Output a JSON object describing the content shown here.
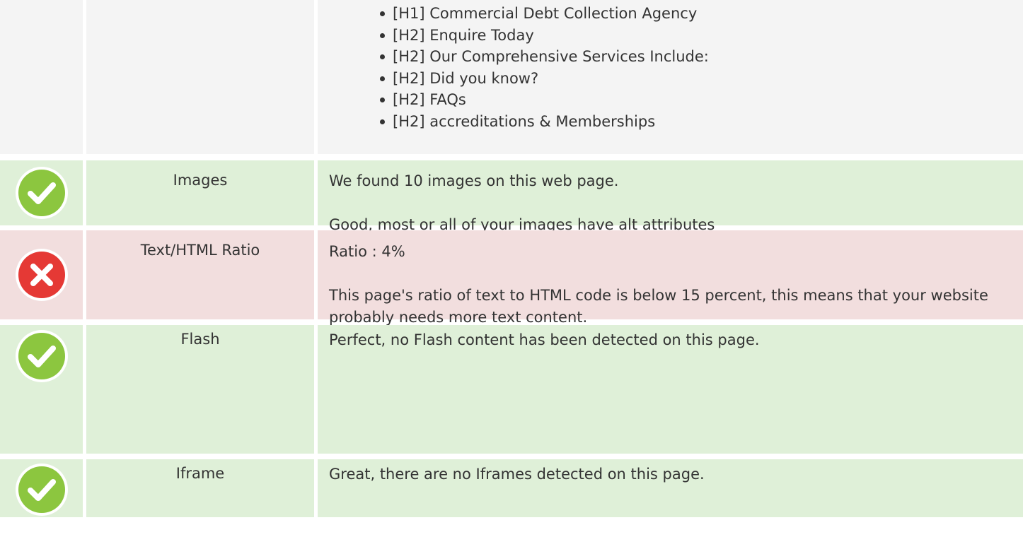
{
  "headings": {
    "items": [
      "[H1] Commercial Debt Collection Agency",
      "[H2] Enquire Today",
      "[H2] Our Comprehensive Services Include:",
      "[H2] Did you know?",
      "[H2] FAQs",
      "[H2] accreditations & Memberships"
    ]
  },
  "rows": [
    {
      "status": "pass",
      "icon": "check-circle-icon",
      "label": "Images",
      "line1": "We found 10 images on this web page.",
      "line2": "Good, most or all of your images have alt attributes"
    },
    {
      "status": "fail",
      "icon": "error-circle-icon",
      "label": "Text/HTML Ratio",
      "line1": "Ratio : 4%",
      "line2": "This page's ratio of text to HTML code is below 15 percent, this means that your website probably needs more text content."
    },
    {
      "status": "pass",
      "icon": "check-circle-icon",
      "label": "Flash",
      "line1": "Perfect, no Flash content has been detected on this page."
    },
    {
      "status": "pass",
      "icon": "check-circle-icon",
      "label": "Iframe",
      "line1": "Great, there are no Iframes detected on this page."
    }
  ],
  "colors": {
    "pass_bg": "#dff0d8",
    "fail_bg": "#f2dede",
    "neutral_bg": "#f4f4f4",
    "pass_icon": "#8cc63f",
    "fail_icon": "#e53935"
  }
}
